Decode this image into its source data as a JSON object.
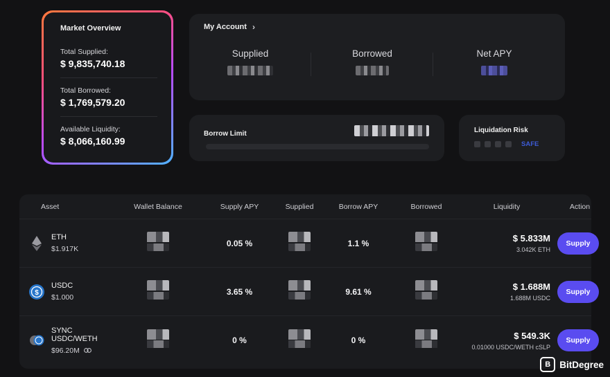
{
  "market_overview": {
    "title": "Market Overview",
    "total_supplied_label": "Total Supplied:",
    "total_supplied": "$ 9,835,740.18",
    "total_borrowed_label": "Total Borrowed:",
    "total_borrowed": "$ 1,769,579.20",
    "available_liquidity_label": "Available Liquidity:",
    "available_liquidity": "$ 8,066,160.99"
  },
  "account": {
    "title": "My Account",
    "supplied_label": "Supplied",
    "borrowed_label": "Borrowed",
    "net_apy_label": "Net APY"
  },
  "borrow_limit": {
    "label": "Borrow Limit"
  },
  "liquidation_risk": {
    "label": "Liquidation Risk",
    "status": "SAFE",
    "status_color": "#3d5bd6"
  },
  "table": {
    "headers": [
      "Asset",
      "Wallet Balance",
      "Supply APY",
      "Supplied",
      "Borrow APY",
      "Borrowed",
      "Liquidity",
      "Action"
    ],
    "rows": [
      {
        "asset": "ETH",
        "price": "$1.917K",
        "icon": "ethereum-icon",
        "supply_apy": "0.05 %",
        "borrow_apy": "1.1 %",
        "liquidity": "$ 5.833M",
        "liquidity_sub": "3.042K ETH",
        "action": "Supply"
      },
      {
        "asset": "USDC",
        "price": "$1.000",
        "icon": "usdc-icon",
        "supply_apy": "3.65 %",
        "borrow_apy": "9.61 %",
        "liquidity": "$ 1.688M",
        "liquidity_sub": "1.688M USDC",
        "action": "Supply"
      },
      {
        "asset": "SYNC USDC/WETH",
        "price": "$96.20M",
        "icon": "sync-lp-icon",
        "supply_apy": "0 %",
        "borrow_apy": "0 %",
        "liquidity": "$ 549.3K",
        "liquidity_sub": "0.01000 USDC/WETH cSLP",
        "action": "Supply"
      }
    ]
  },
  "watermark": {
    "text": "BitDegree"
  },
  "colors": {
    "accent": "#5a4cf0",
    "background": "#121214",
    "card": "#1d1e21"
  }
}
